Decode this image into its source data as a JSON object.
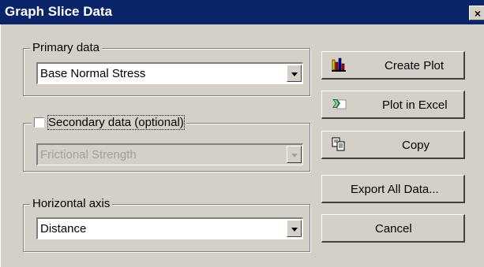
{
  "window": {
    "title": "Graph Slice Data",
    "close_label": "×"
  },
  "primary": {
    "label": "Primary data",
    "value": "Base Normal Stress"
  },
  "secondary": {
    "label": "Secondary data (optional)",
    "value": "Frictional Strength",
    "checked": false,
    "enabled": false
  },
  "horizontal": {
    "label": "Horizontal axis",
    "value": "Distance"
  },
  "buttons": {
    "create_plot": {
      "label": "Create Plot",
      "icon": "bar-chart-icon"
    },
    "plot_excel": {
      "label": "Plot in Excel",
      "icon": "excel-icon"
    },
    "copy": {
      "label": "Copy",
      "icon": "copy-icon"
    },
    "export": {
      "label": "Export All Data..."
    },
    "cancel": {
      "label": "Cancel"
    }
  }
}
